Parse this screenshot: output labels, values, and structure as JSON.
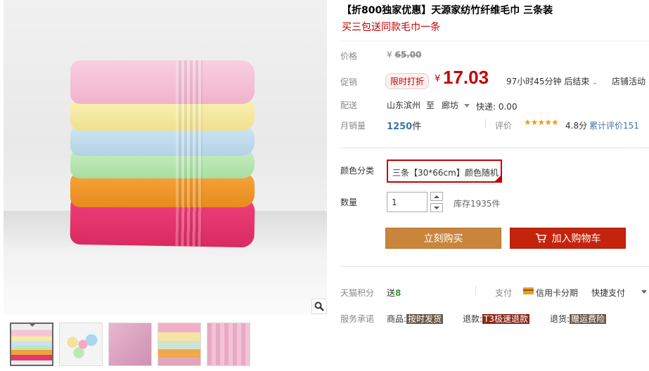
{
  "product": {
    "title": "【折800独家优惠】天源家纺竹纤维毛巾 三条装",
    "subtitle": "买三包送同款毛巾一条"
  },
  "gallery": {
    "thumbnail_count": 5
  },
  "price": {
    "label": "价格",
    "currency": "¥",
    "original": "65.00",
    "promo_label": "促销",
    "promo_tag": "限时打折",
    "current": "17.03",
    "countdown": "97小时45分钟 后结束",
    "store_activity": "店铺活动"
  },
  "shipping": {
    "label": "配送",
    "from": "山东滨州",
    "to_word": "至",
    "to_city": "廊坊",
    "fee": "快递: 0.00"
  },
  "sales": {
    "label": "月销量",
    "count": "1250",
    "unit": "件",
    "rating_label": "评价",
    "stars": "★★★★★",
    "score": "4.8分",
    "review_text": "累计评价151"
  },
  "sku": {
    "color_label": "颜色分类",
    "selected_option": "三条【30*66cm】颜色随机"
  },
  "quantity": {
    "label": "数量",
    "value": "1",
    "stock": "库存1935件"
  },
  "actions": {
    "buy_now": "立刻购买",
    "add_to_cart": "加入购物车"
  },
  "points": {
    "label": "天猫积分",
    "prefix": "送",
    "value": "8"
  },
  "payment": {
    "label": "支付",
    "card": "信用卡分期",
    "quickpay": "快捷支付"
  },
  "service": {
    "label": "服务承诺",
    "item1_prefix": "商品:",
    "item1_tag": "按时发货",
    "item2_prefix": "退款:",
    "item2_tag": "T3极速退款",
    "item3_prefix": "退货:",
    "item3_tag": "赠运费险"
  },
  "colors": {
    "accent": "#c40000",
    "buy_button": "#c9853c",
    "cart_button": "#c4230c",
    "link": "#3c76a8",
    "star": "#e6a020"
  }
}
